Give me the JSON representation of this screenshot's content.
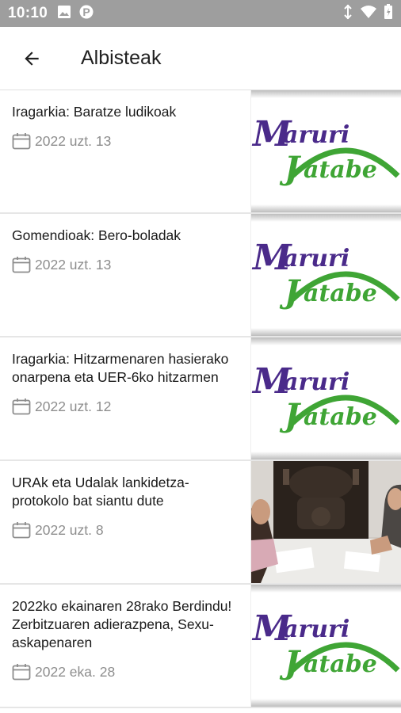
{
  "status_bar": {
    "time": "10:10",
    "left_icons": [
      "image-icon",
      "parking-icon"
    ],
    "right_icons": [
      "vibrate-icon",
      "wifi-icon",
      "battery-icon"
    ],
    "color": "#9e9e9e"
  },
  "app_bar": {
    "title": "Albisteak",
    "back_icon": "arrow-left-icon"
  },
  "logo": {
    "line1": "Maruri",
    "line2": "Jatabe",
    "purple": "#4a2a8a",
    "green": "#3fa535"
  },
  "news": [
    {
      "title": "Iragarkia: Baratze ludikoak",
      "date": "2022 uzt. 13",
      "thumbnail": "logo"
    },
    {
      "title": "Gomendioak: Bero-boladak",
      "date": "2022 uzt. 13",
      "thumbnail": "logo"
    },
    {
      "title": "Iragarkia: Hitzarmenaren hasierako onarpena eta UER-6ko hitzarmen",
      "date": "2022 uzt. 12",
      "thumbnail": "logo"
    },
    {
      "title": "URAk eta Udalak lankidetza-protokolo bat siantu dute",
      "date": "2022 uzt. 8",
      "thumbnail": "photo"
    },
    {
      "title": "2022ko ekainaren 28rako Berdindu! Zerbitzuaren adierazpena, Sexu-askapenaren",
      "date": "2022 eka. 28",
      "thumbnail": "logo"
    }
  ]
}
